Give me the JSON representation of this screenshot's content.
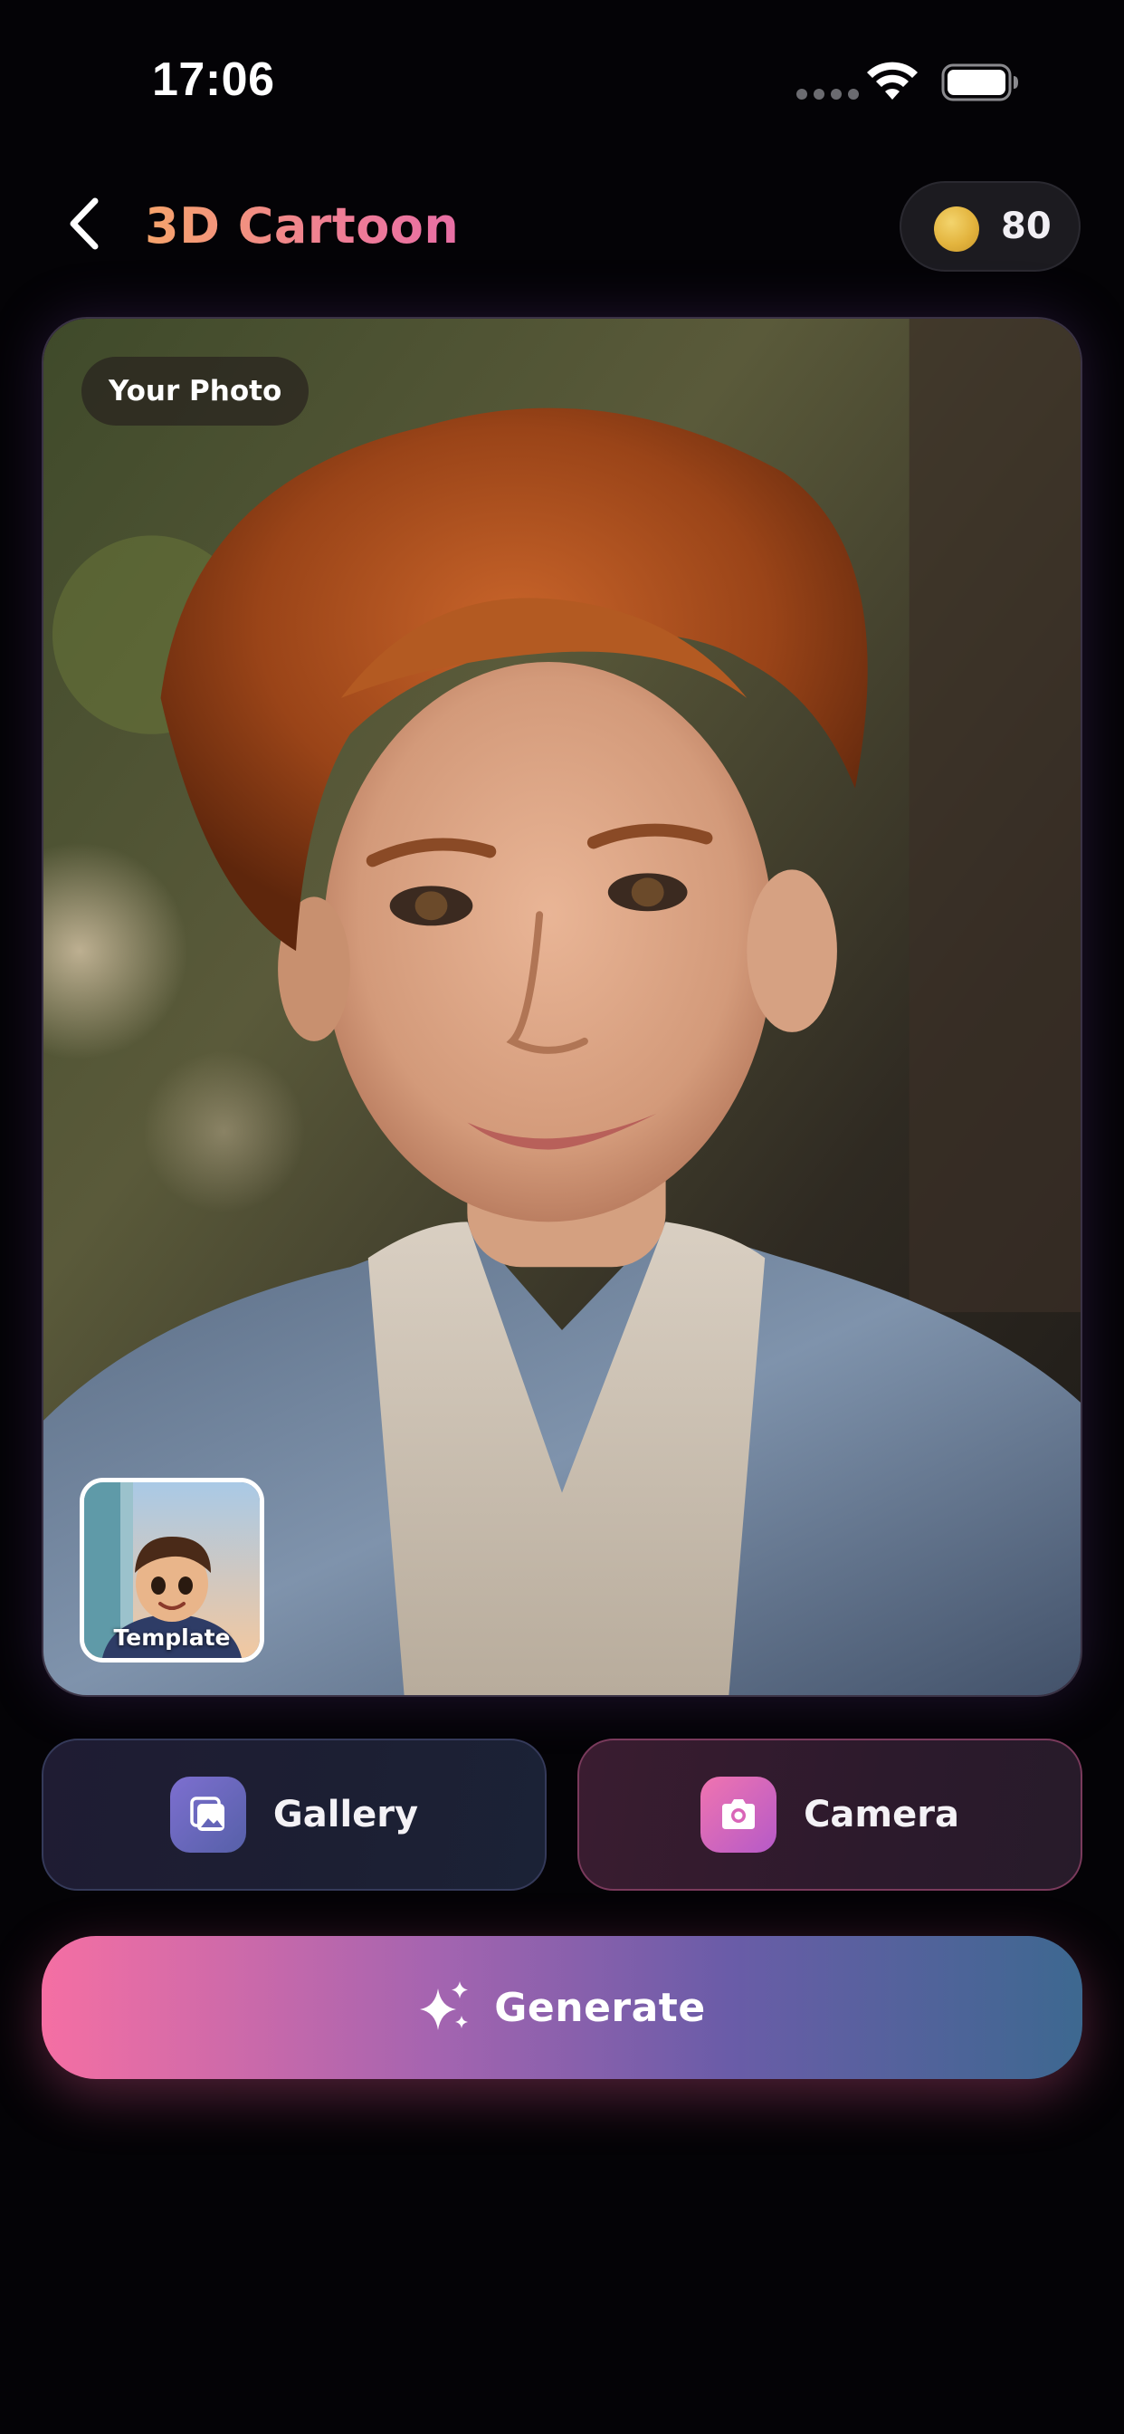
{
  "status_bar": {
    "time": "17:06"
  },
  "header": {
    "title": "3D Cartoon",
    "coins": "80",
    "back_icon": "chevron-left-icon",
    "coin_icon": "coin-icon"
  },
  "photo": {
    "label": "Your Photo",
    "template_label": "Template"
  },
  "actions": {
    "gallery_label": "Gallery",
    "camera_label": "Camera",
    "generate_label": "Generate"
  },
  "colors": {
    "background": "#040306",
    "title_gradient_start": "#f6a46b",
    "title_gradient_end": "#e86fa5",
    "coin": "#e3b43e",
    "generate_gradient_start": "#f56fa3",
    "generate_gradient_end": "#3d6890"
  }
}
